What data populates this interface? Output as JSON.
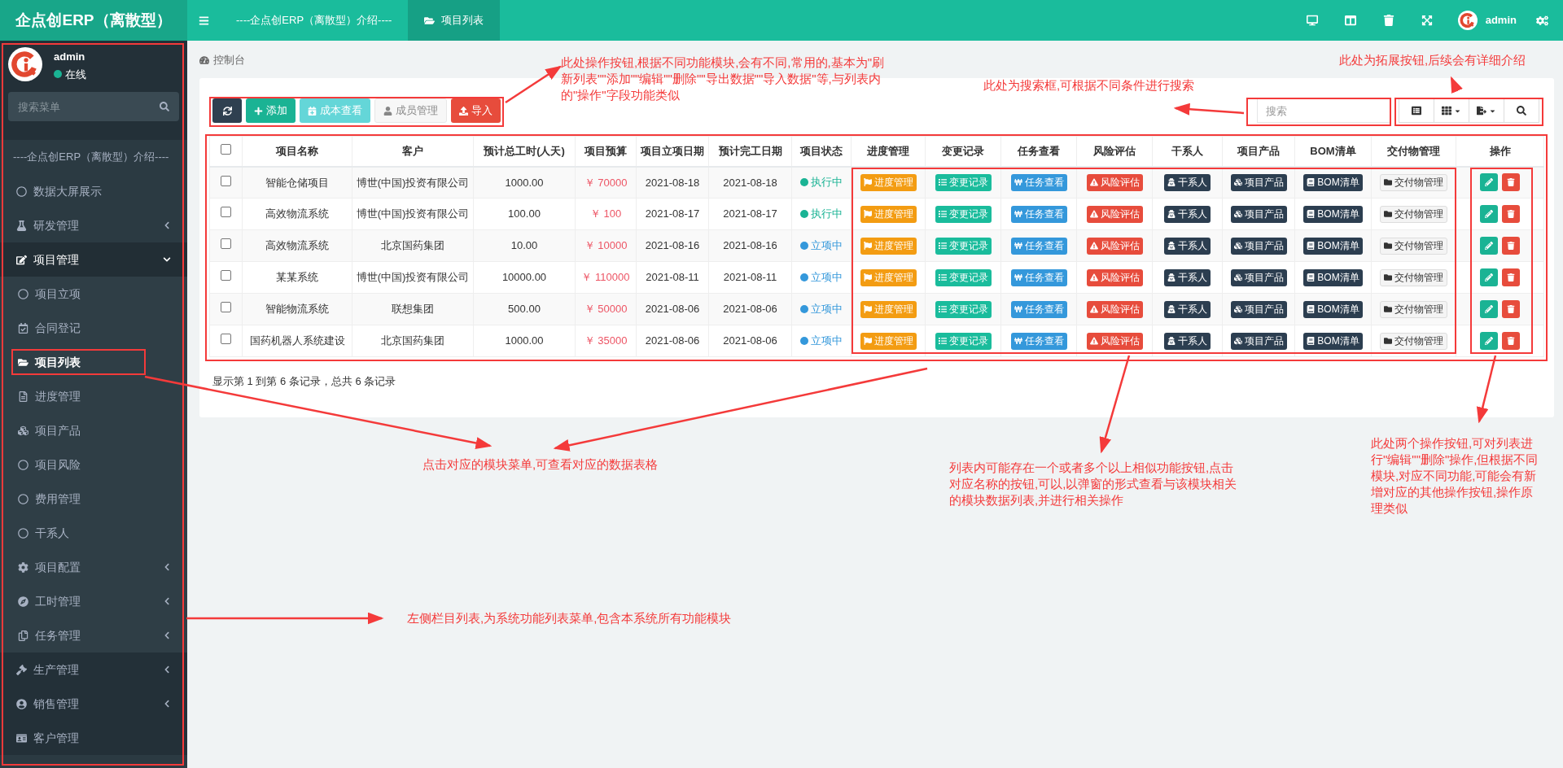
{
  "topbar": {
    "brand": "企点创ERP（离散型）",
    "tabs": [
      {
        "label": "----企点创ERP（离散型）介绍----",
        "selected": false
      },
      {
        "label": "项目列表",
        "selected": true
      }
    ],
    "user": "admin"
  },
  "sidebar": {
    "user": {
      "name": "admin",
      "status": "在线"
    },
    "search": {
      "placeholder": "搜索菜单"
    },
    "menu": [
      {
        "label": "----企点创ERP（离散型）介绍----",
        "selected": false
      },
      {
        "label": "数据大屏展示",
        "selected": false
      },
      {
        "label": "研发管理",
        "selected": false,
        "expanded": false
      },
      {
        "label": "项目管理",
        "selected": false,
        "expanded": true,
        "children": [
          {
            "label": "项目立项",
            "selected": false
          },
          {
            "label": "合同登记",
            "selected": false
          },
          {
            "label": "项目列表",
            "selected": true
          },
          {
            "label": "进度管理",
            "selected": false
          },
          {
            "label": "项目产品",
            "selected": false
          },
          {
            "label": "项目风险",
            "selected": false
          },
          {
            "label": "费用管理",
            "selected": false
          },
          {
            "label": "干系人",
            "selected": false
          },
          {
            "label": "项目配置",
            "selected": false,
            "expanded": false
          },
          {
            "label": "工时管理",
            "selected": false,
            "expanded": false
          },
          {
            "label": "任务管理",
            "selected": false,
            "expanded": false
          }
        ]
      },
      {
        "label": "生产管理",
        "selected": false,
        "expanded": false
      },
      {
        "label": "销售管理",
        "selected": false,
        "expanded": false
      },
      {
        "label": "客户管理",
        "selected": false
      }
    ]
  },
  "breadcrumb": "控制台",
  "toolbar": [
    {
      "label": "添加",
      "disabled": false
    },
    {
      "label": "成本查看",
      "disabled": true
    },
    {
      "label": "成员管理",
      "disabled": true
    },
    {
      "label": "导入",
      "disabled": false
    }
  ],
  "search": {
    "placeholder": "搜索"
  },
  "table": {
    "all_checked": false,
    "columns": [
      "项目名称",
      "客户",
      "预计总工时(人天)",
      "项目预算",
      "项目立项日期",
      "预计完工日期",
      "项目状态",
      "进度管理",
      "变更记录",
      "任务查看",
      "风险评估",
      "干系人",
      "项目产品",
      "BOM清单",
      "交付物管理",
      "操作"
    ],
    "rows": [
      {
        "checked": false,
        "cells": [
          "智能仓储项目",
          "博世(中国)投资有限公司",
          "1000.00",
          "￥ 70000",
          "2021-08-18",
          "2021-08-18"
        ],
        "status": {
          "label": "执行中",
          "color": "#1ab394"
        },
        "buttons": [
          "进度管理",
          "变更记录",
          "任务查看",
          "风险评估",
          "干系人",
          "项目产品",
          "BOM清单",
          "交付物管理"
        ]
      },
      {
        "checked": false,
        "cells": [
          "高效物流系统",
          "博世(中国)投资有限公司",
          "100.00",
          "￥ 100",
          "2021-08-17",
          "2021-08-17"
        ],
        "status": {
          "label": "执行中",
          "color": "#1ab394"
        },
        "buttons": [
          "进度管理",
          "变更记录",
          "任务查看",
          "风险评估",
          "干系人",
          "项目产品",
          "BOM清单",
          "交付物管理"
        ]
      },
      {
        "checked": false,
        "cells": [
          "高效物流系统",
          "北京国药集团",
          "10.00",
          "￥ 10000",
          "2021-08-16",
          "2021-08-16"
        ],
        "status": {
          "label": "立项中",
          "color": "#3498db"
        },
        "buttons": [
          "进度管理",
          "变更记录",
          "任务查看",
          "风险评估",
          "干系人",
          "项目产品",
          "BOM清单",
          "交付物管理"
        ]
      },
      {
        "checked": false,
        "cells": [
          "某某系统",
          "博世(中国)投资有限公司",
          "10000.00",
          "￥ 110000",
          "2021-08-11",
          "2021-08-11"
        ],
        "status": {
          "label": "立项中",
          "color": "#3498db"
        },
        "buttons": [
          "进度管理",
          "变更记录",
          "任务查看",
          "风险评估",
          "干系人",
          "项目产品",
          "BOM清单",
          "交付物管理"
        ]
      },
      {
        "checked": false,
        "cells": [
          "智能物流系统",
          "联想集团",
          "500.00",
          "￥ 50000",
          "2021-08-06",
          "2021-08-06"
        ],
        "status": {
          "label": "立项中",
          "color": "#3498db"
        },
        "buttons": [
          "进度管理",
          "变更记录",
          "任务查看",
          "风险评估",
          "干系人",
          "项目产品",
          "BOM清单",
          "交付物管理"
        ]
      },
      {
        "checked": false,
        "cells": [
          "国药机器人系统建设",
          "北京国药集团",
          "1000.00",
          "￥ 35000",
          "2021-08-06",
          "2021-08-06"
        ],
        "status": {
          "label": "立项中",
          "color": "#3498db"
        },
        "buttons": [
          "进度管理",
          "变更记录",
          "任务查看",
          "风险评估",
          "干系人",
          "项目产品",
          "BOM清单",
          "交付物管理"
        ]
      }
    ],
    "footer": "显示第 1 到第 6 条记录，总共 6 条记录"
  },
  "annotations": [
    "此处操作按钮,根据不同功能模块,会有不同,常用的,基本为\"刷新列表\"\"添加\"\"编辑\"\"删除\"\"导出数据\"\"导入数据\"等,与列表内的\"操作\"字段功能类似",
    "此处为搜索框,可根据不同条件进行搜索",
    "此处为拓展按钮,后续会有详细介绍",
    "点击对应的模块菜单,可查看对应的数据表格",
    "列表内可能存在一个或者多个以上相似功能按钮,点击对应名称的按钮,可以,以弹窗的形式查看与该模块相关的模块数据列表,并进行相关操作",
    "此处两个操作按钮,可对列表进行\"编辑\"\"删除\"操作,但根据不同模块,对应不同功能,可能会有新增对应的其他操作按钮,操作原理类似",
    "左侧栏目列表,为系统功能列表菜单,包含本系统所有功能模块"
  ]
}
